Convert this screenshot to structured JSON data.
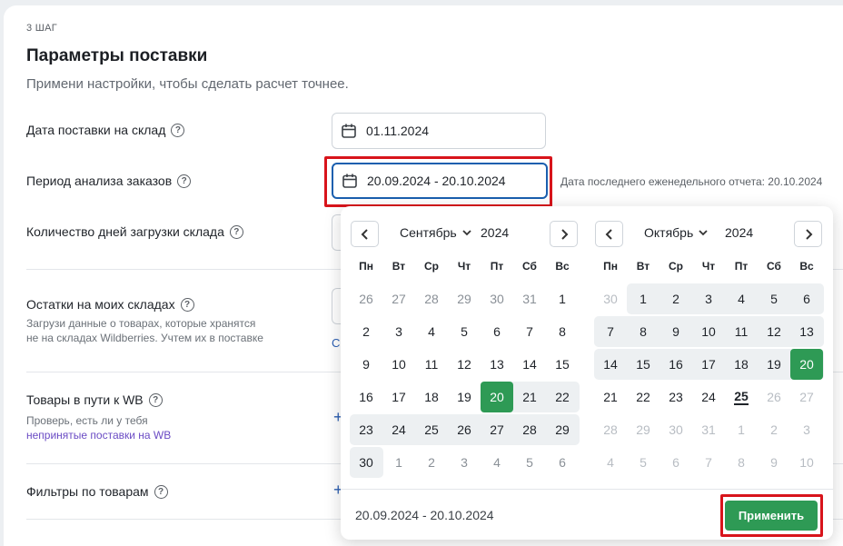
{
  "step": "3 ШАГ",
  "title": "Параметры поставки",
  "subtitle": "Примени настройки, чтобы сделать расчет точнее.",
  "rows": {
    "delivery_date_label": "Дата поставки на склад",
    "delivery_date_value": "01.11.2024",
    "period_label": "Период анализа заказов",
    "period_value": "20.09.2024 - 20.10.2024",
    "period_note": "Дата последнего еженедельного отчета: 20.10.2024",
    "load_days_label": "Количество дней загрузки склада",
    "stock_label": "Остатки на моих складах",
    "stock_hint_1": "Загрузи данные о товарах, которые хранятся",
    "stock_hint_2": "не на складах Wildberries. Учтем их в поставке",
    "stock_link_fragment": "С",
    "transit_label": "Товары в пути к WB",
    "transit_hint": "Проверь, есть ли у тебя",
    "transit_link": "непринятые поставки на WB",
    "filters_label": "Фильтры по товарам"
  },
  "datepicker": {
    "weekdays": [
      "Пн",
      "Вт",
      "Ср",
      "Чт",
      "Пт",
      "Сб",
      "Вс"
    ],
    "left": {
      "month": "Сентябрь",
      "year": "2024",
      "weeks": [
        [
          "26",
          "27",
          "28",
          "29",
          "30",
          "31",
          "1"
        ],
        [
          "2",
          "3",
          "4",
          "5",
          "6",
          "7",
          "8"
        ],
        [
          "9",
          "10",
          "11",
          "12",
          "13",
          "14",
          "15"
        ],
        [
          "16",
          "17",
          "18",
          "19",
          "20",
          "21",
          "22"
        ],
        [
          "23",
          "24",
          "25",
          "26",
          "27",
          "28",
          "29"
        ],
        [
          "30",
          "1",
          "2",
          "3",
          "4",
          "5",
          "6"
        ]
      ]
    },
    "right": {
      "month": "Октябрь",
      "year": "2024",
      "weeks": [
        [
          "30",
          "1",
          "2",
          "3",
          "4",
          "5",
          "6"
        ],
        [
          "7",
          "8",
          "9",
          "10",
          "11",
          "12",
          "13"
        ],
        [
          "14",
          "15",
          "16",
          "17",
          "18",
          "19",
          "20"
        ],
        [
          "21",
          "22",
          "23",
          "24",
          "25",
          "26",
          "27"
        ],
        [
          "28",
          "29",
          "30",
          "31",
          "1",
          "2",
          "3"
        ],
        [
          "4",
          "5",
          "6",
          "7",
          "8",
          "9",
          "10"
        ]
      ]
    },
    "range_text": "20.09.2024 - 20.10.2024",
    "apply_label": "Применить"
  },
  "colors": {
    "accent_green": "#2e9a55",
    "highlight_red": "#d8141b",
    "focus_blue": "#1a5faf",
    "link_purple": "#6a4bc4"
  },
  "icons": {
    "calendar": "calendar-icon",
    "help": "help-icon",
    "prev": "chevron-left-icon",
    "next": "chevron-right-icon",
    "dropdown": "chevron-down-icon",
    "add": "plus-icon"
  }
}
